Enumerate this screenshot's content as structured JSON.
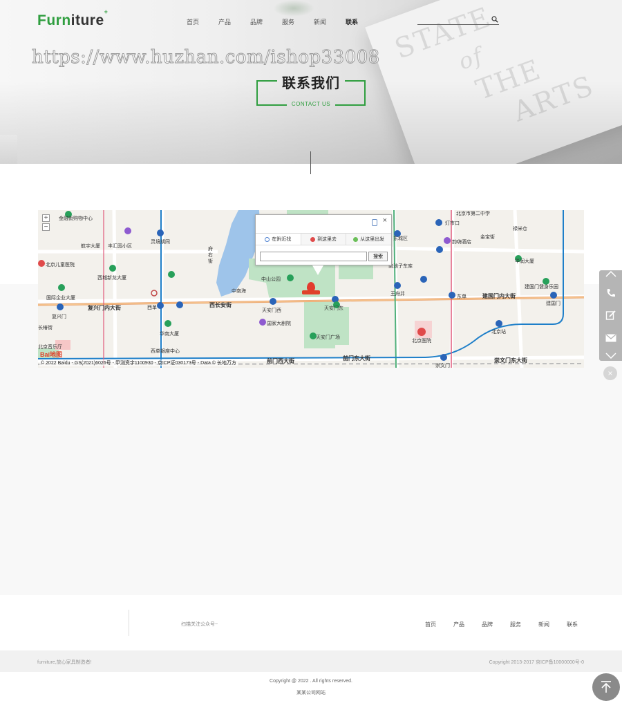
{
  "header": {
    "logo_green": "Furn",
    "logo_dark": "iture",
    "logo_sup": "+",
    "nav": [
      "首页",
      "产品",
      "品牌",
      "服务",
      "新闻",
      "联系"
    ],
    "active_nav": "联系",
    "search_placeholder": ""
  },
  "hero": {
    "watermark": "https://www.huzhan.com/ishop33008",
    "background_text": [
      "STATE",
      "of",
      "THE",
      "ARTS"
    ],
    "title_cn": "联系我们",
    "title_en": "CONTACT US"
  },
  "map": {
    "popup": {
      "tabs": [
        "在附近找",
        "到这里去",
        "从这里出发"
      ],
      "search_button": "搜索",
      "input_value": ""
    },
    "zoom": [
      "+",
      "−"
    ],
    "places": [
      "金融街购物中心",
      "航宇大厦",
      "丰汇园小区",
      "灵境胡同",
      "府右街",
      "中南海",
      "北京儿童医院",
      "西城新龙大厦",
      "西单",
      "国际企业大厦",
      "复兴门内大街",
      "复兴门",
      "西长安街",
      "天安门西",
      "天安门东",
      "国家大剧院",
      "天安门广场",
      "华南大厦",
      "西单银座中心",
      "前门西大街",
      "前门东大街",
      "中山公园",
      "北京市第二中学",
      "灯市口",
      "禄米仓",
      "金宝街",
      "韵嗨酒店",
      "华润大厦",
      "王府井",
      "东单",
      "建国门内大街",
      "建国门健身乐园",
      "建国门",
      "北京站",
      "北京医院",
      "崇文门",
      "崇文门东大街",
      "南池子东库",
      "东城区",
      "北京音乐厅",
      "长椿街",
      "灯市口"
    ],
    "copyright": "© 2022 Baidu - GS(2021)6026号 - 甲测资字1100930 - 京ICP证030173号 - Data © 长地万方",
    "brand": "Bai地图"
  },
  "sidebar": {
    "items": [
      "up-arrow",
      "phone",
      "edit",
      "mail",
      "down-arrow"
    ]
  },
  "footer": {
    "qr_caption": "扫描关注公众号~",
    "nav": [
      "首页",
      "产品",
      "品牌",
      "服务",
      "新闻",
      "联系"
    ],
    "slogan": "furniture,放心家具制造者!",
    "icp": "Copyright 2013-2017 京ICP备10000000号-0",
    "copyright": "Copyright @ 2022 . All rights reserved.",
    "company": "某某公司网站"
  },
  "colors": {
    "accent_green": "#2f9e3f",
    "map_water": "#9ec4ea",
    "map_park": "#bfe3c5",
    "map_road": "#ffffff",
    "map_route": "#e67a4a"
  }
}
